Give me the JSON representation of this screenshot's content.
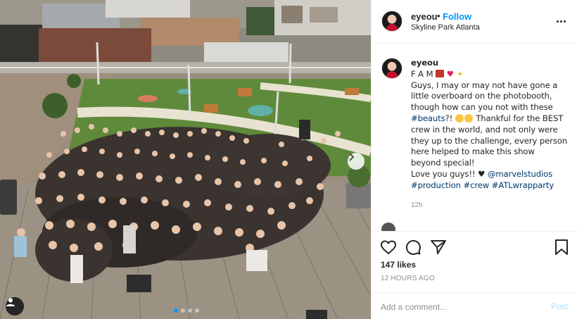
{
  "post": {
    "username": "eyeou",
    "separator": "•",
    "follow_label": "Follow",
    "location": "Skyline Park Atlanta",
    "caption": {
      "username": "eyeou",
      "title_text": "F A M",
      "line1": "Guys, I may or may not have gone a",
      "line2": "little overboard on the photobooth,",
      "line3": "though how can you not with these",
      "hashtag_beauts": "#beauts",
      "line4_rest": "?! ",
      "line4_after": " Thankful for the BEST",
      "line5": "crew in the world, and not only were",
      "line6": "they up to the challenge, every person",
      "line7": "here helped to make this show",
      "line8": "beyond special!",
      "line9_text": "Love you guys!! ♥ ",
      "mention": "@marvelstudios",
      "hashtag1": "#production",
      "hashtag2": "#crew",
      "hashtag3": "#ATLwrapparty"
    },
    "caption_time": "12h",
    "likes": "147 likes",
    "timestamp": "12 HOURS AGO",
    "comment_placeholder": "Add a comment...",
    "post_label": "Post"
  },
  "colors": {
    "accent": "#0095f6",
    "link": "#00376b",
    "muted": "#8e8e8e"
  },
  "icons": {
    "more": "more-options-icon",
    "like": "heart-icon",
    "comment": "comment-icon",
    "share": "paper-plane-icon",
    "save": "bookmark-icon",
    "carousel_next": "chevron-right-icon",
    "tag": "user-tag-icon"
  },
  "carousel": {
    "slide_count": 4,
    "active_index": 0
  }
}
